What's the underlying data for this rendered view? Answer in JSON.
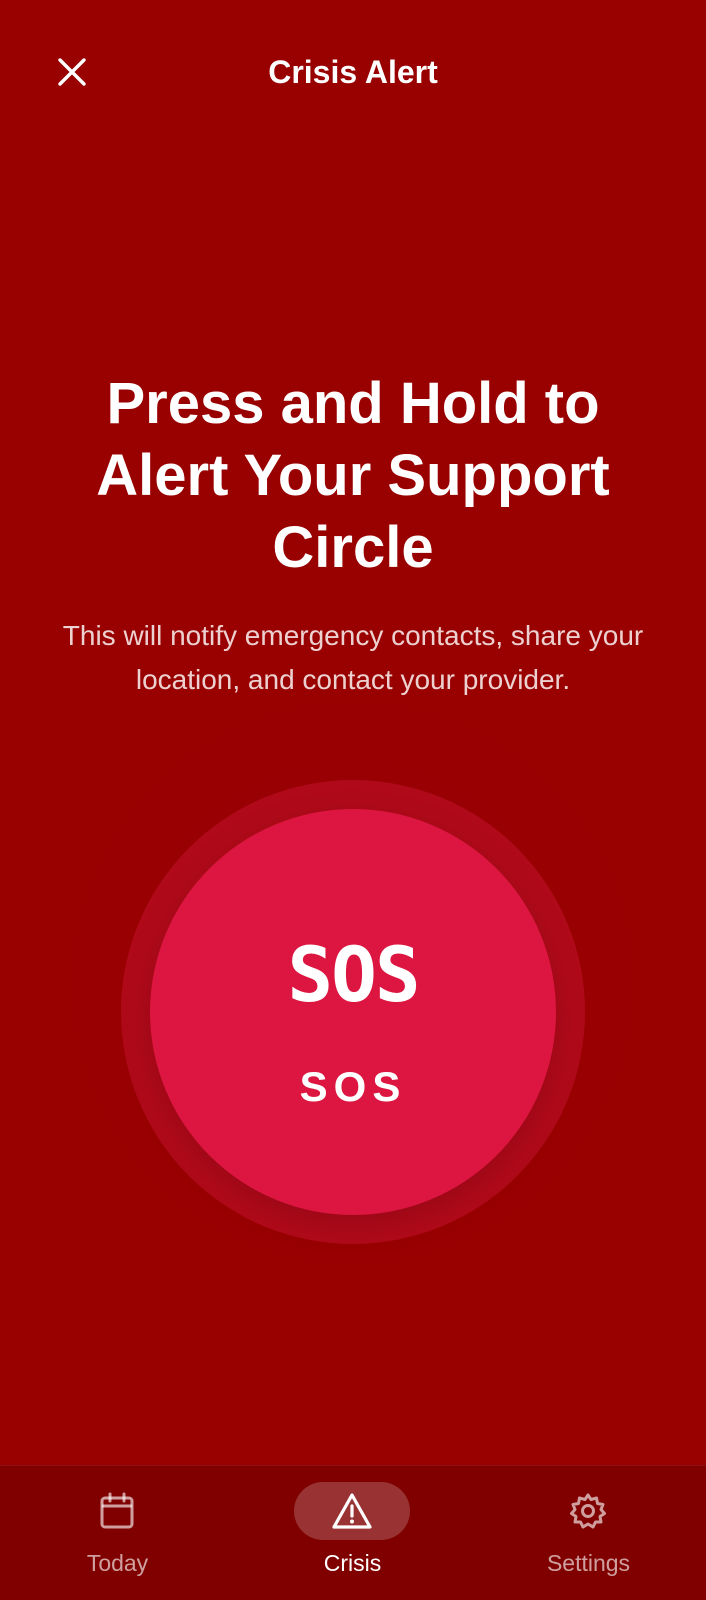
{
  "header": {
    "title": "Crisis Alert",
    "close_icon": "close-icon"
  },
  "main": {
    "headline": "Press and Hold to Alert Your Support Circle",
    "description": "This will notify emergency contacts, share your location, and contact your provider.",
    "sos_button": {
      "icon_text": "SOS",
      "label": "SOS"
    }
  },
  "bottom_nav": {
    "items": [
      {
        "label": "Today",
        "icon": "calendar-icon",
        "active": false
      },
      {
        "label": "Crisis",
        "icon": "warning-icon",
        "active": true
      },
      {
        "label": "Settings",
        "icon": "gear-icon",
        "active": false
      }
    ]
  },
  "colors": {
    "background": "#990000",
    "sos_button": "#dc1640",
    "sos_ring": "#b00a1a",
    "nav_background": "#800000"
  }
}
